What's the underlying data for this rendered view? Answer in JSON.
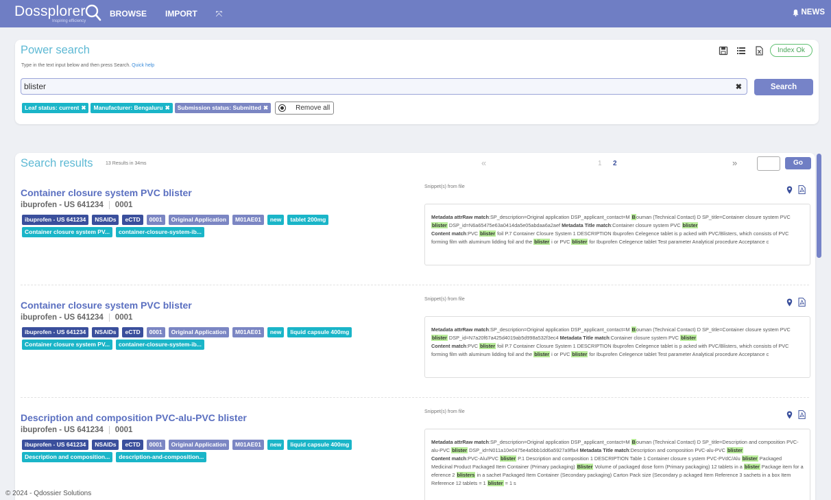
{
  "header": {
    "logo_text": "Dossplorer",
    "logo_tagline": "Inspiring efficiency",
    "nav": [
      {
        "label": "BROWSE",
        "icon": "",
        "ico": ""
      },
      {
        "label": "IMPORT",
        "icon": "",
        "ico": ""
      },
      {
        "label": "",
        "icon": "expand-icon",
        "ico": "⤧"
      }
    ],
    "news_label": "NEWS",
    "news_icon": "bell-icon",
    "brand_color": "#6f7ec4"
  },
  "power_search": {
    "title": "Power search",
    "help_text": "Type in the text input below and then press Search.",
    "help_link": "Quick help",
    "icons": [
      "save-icon",
      "list-icon",
      "export-file-icon"
    ],
    "index_status": "Index Ok",
    "query": "blister",
    "search_button": "Search",
    "filters": [
      {
        "label": "Leaf status: current",
        "style": "teal"
      },
      {
        "label": "Manufacturer: Bengaluru",
        "style": "teal"
      },
      {
        "label": "Submission status: Submitted",
        "style": "purple"
      }
    ],
    "remove_all": "Remove all"
  },
  "results": {
    "title": "Search results",
    "count_text": "13 Results in 34ms",
    "pagination": {
      "prev": "«",
      "pages": [
        "1",
        "2"
      ],
      "current": "2",
      "next": "»"
    },
    "go_button": "Go",
    "snippet_label": "Snippet(s) from file",
    "items": [
      {
        "title": "Container closure system PVC blister",
        "product": "ibuprofen - US 641234",
        "sequence": "0001",
        "tags": [
          {
            "label": "ibuprofen - US 641234",
            "style": "navy"
          },
          {
            "label": "NSAIDs",
            "style": "navy"
          },
          {
            "label": "eCTD",
            "style": "navy"
          },
          {
            "label": "0001",
            "style": "purple"
          },
          {
            "label": "Original Application",
            "style": "purple"
          },
          {
            "label": "M01AE01",
            "style": "purple"
          },
          {
            "label": "new",
            "style": "teal"
          },
          {
            "label": "tablet 200mg",
            "style": "teal"
          },
          {
            "label": "Container closure system PV...",
            "style": "teal"
          },
          {
            "label": "container-closure-system-ib...",
            "style": "teal"
          }
        ],
        "snippet": [
          [
            {
              "t": "Metadata attrRaw match",
              "s": "b"
            },
            {
              "t": ":SP_description=Original application DSP_applicant_contact=M "
            },
            {
              "t": "B",
              "s": "h"
            },
            {
              "t": "ouman (Technical Contact) D SP_title=Container closure system PVC "
            },
            {
              "t": "blister",
              "s": "h"
            },
            {
              "t": " DSP_id=N6a65475e63a0414da5e05abdaa6a2aef "
            },
            {
              "t": "Metadata Title match",
              "s": "b"
            },
            {
              "t": ":Container closure system PVC "
            },
            {
              "t": "blister",
              "s": "h"
            }
          ],
          [
            {
              "t": "Content match",
              "s": "b"
            },
            {
              "t": ":PVC "
            },
            {
              "t": "blister",
              "s": "h"
            },
            {
              "t": " foil P.7 Container Closure System 1 DESCRIPTION Ibuprofen Celegence tablet is p acked with PVC/Blisters, which consists of PVC forming film with aluminum lidding foil and the "
            },
            {
              "t": "blister",
              "s": "h"
            },
            {
              "t": " i or PVC "
            },
            {
              "t": "blister",
              "s": "h"
            },
            {
              "t": " for Ibuprofen Celegence tablet Test parameter Analytical procedure Acceptance c"
            }
          ]
        ]
      },
      {
        "title": "Container closure system PVC blister",
        "product": "ibuprofen - US 641234",
        "sequence": "0001",
        "tags": [
          {
            "label": "ibuprofen - US 641234",
            "style": "navy"
          },
          {
            "label": "NSAIDs",
            "style": "navy"
          },
          {
            "label": "eCTD",
            "style": "navy"
          },
          {
            "label": "0001",
            "style": "purple"
          },
          {
            "label": "Original Application",
            "style": "purple"
          },
          {
            "label": "M01AE01",
            "style": "purple"
          },
          {
            "label": "new",
            "style": "teal"
          },
          {
            "label": "liquid capsule 400mg",
            "style": "teal"
          },
          {
            "label": "Container closure system PV...",
            "style": "teal"
          },
          {
            "label": "container-closure-system-ib...",
            "style": "teal"
          }
        ],
        "snippet": [
          [
            {
              "t": "Metadata attrRaw match",
              "s": "b"
            },
            {
              "t": ":SP_description=Original application DSP_applicant_contact=M "
            },
            {
              "t": "B",
              "s": "h"
            },
            {
              "t": "ouman (Technical Contact) D SP_title=Container closure system PVC "
            },
            {
              "t": "blister",
              "s": "h"
            },
            {
              "t": " DSP_id=N7a20f67a425d4019ab5d998a532f3ec4 "
            },
            {
              "t": "Metadata Title match",
              "s": "b"
            },
            {
              "t": ":Container closure system PVC "
            },
            {
              "t": "blister",
              "s": "h"
            }
          ],
          [
            {
              "t": "Content match",
              "s": "b"
            },
            {
              "t": ":PVC "
            },
            {
              "t": "blister",
              "s": "h"
            },
            {
              "t": " foil P.7 Container Closure System 1 DESCRIPTION Ibuprofen Celegence tablet is p acked with PVC/Blisters, which consists of PVC forming film with aluminum lidding foil and the "
            },
            {
              "t": "blister",
              "s": "h"
            },
            {
              "t": " i or PVC "
            },
            {
              "t": "blister",
              "s": "h"
            },
            {
              "t": " for Ibuprofen Celegence tablet Test parameter Analytical procedure Acceptance c"
            }
          ]
        ]
      },
      {
        "title": "Description and composition PVC-alu-PVC blister",
        "product": "ibuprofen - US 641234",
        "sequence": "0001",
        "tags": [
          {
            "label": "ibuprofen - US 641234",
            "style": "navy"
          },
          {
            "label": "NSAIDs",
            "style": "navy"
          },
          {
            "label": "eCTD",
            "style": "navy"
          },
          {
            "label": "0001",
            "style": "purple"
          },
          {
            "label": "Original Application",
            "style": "purple"
          },
          {
            "label": "M01AE01",
            "style": "purple"
          },
          {
            "label": "new",
            "style": "teal"
          },
          {
            "label": "liquid capsule 400mg",
            "style": "teal"
          },
          {
            "label": "Description and composition...",
            "style": "teal"
          },
          {
            "label": "description-and-composition...",
            "style": "teal"
          }
        ],
        "snippet": [
          [
            {
              "t": "Metadata attrRaw match",
              "s": "b"
            },
            {
              "t": ":SP_description=Original application DSP_applicant_contact=M "
            },
            {
              "t": "B",
              "s": "h"
            },
            {
              "t": "ouman (Technical Contact) D SP_title=Description and composition PVC-alu-PVC "
            },
            {
              "t": "blister",
              "s": "h"
            },
            {
              "t": " DSP_id=N011a10e0475e4a5bb1dd6a5927a9ffa4 "
            },
            {
              "t": "Metadata Title match",
              "s": "b"
            },
            {
              "t": ":Description and composition PVC-alu-PVC "
            },
            {
              "t": "blister",
              "s": "h"
            }
          ],
          [
            {
              "t": "Content match",
              "s": "b"
            },
            {
              "t": ":PVC-Alu/PVC "
            },
            {
              "t": "blister",
              "s": "h"
            },
            {
              "t": " P.1 Description and composition 1 DESCRIPTION Table 1 Container closure s ystem PVC-PVdC/Alu "
            },
            {
              "t": "blister",
              "s": "h"
            },
            {
              "t": " Packaged Medicinal Product Packaged Item Container (Primary packaging) "
            },
            {
              "t": "Blister",
              "s": "h"
            },
            {
              "t": " Volume of packaged dose form (Primary packaging) 12 tablets in a "
            },
            {
              "t": "blister",
              "s": "h"
            },
            {
              "t": " Package item for a eference 2 "
            },
            {
              "t": "blisters",
              "s": "h"
            },
            {
              "t": " in a sachet Packaged Item Container (Secondary packaging) Carton Pack size (Secondary p ackaged Item Reference 3 sachets in a box Item Reference 12 tablets = 1 "
            },
            {
              "t": "blister",
              "s": "h"
            },
            {
              "t": " = 1 s"
            }
          ]
        ]
      }
    ]
  },
  "footer": {
    "text": "© 2024 - Qdossier Solutions"
  }
}
